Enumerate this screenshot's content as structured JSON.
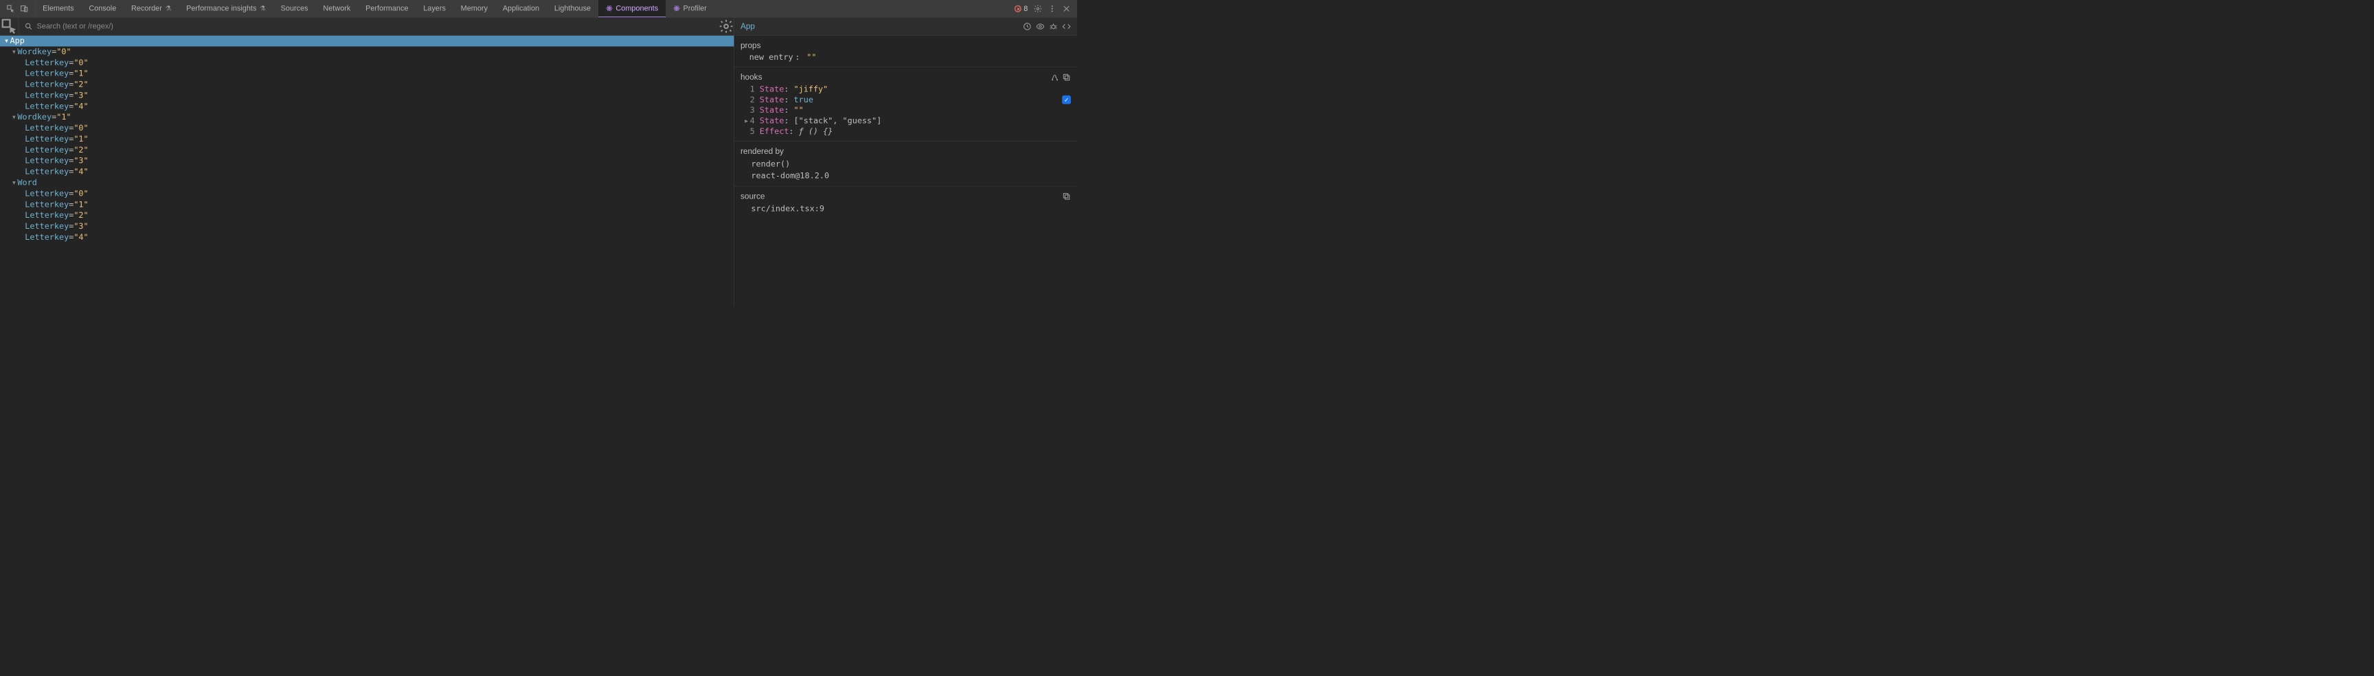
{
  "tabs": {
    "items": [
      {
        "label": "Elements",
        "id": "elements"
      },
      {
        "label": "Console",
        "id": "console"
      },
      {
        "label": "Recorder",
        "id": "recorder",
        "beaker": true
      },
      {
        "label": "Performance insights",
        "id": "perf-insights",
        "beaker": true
      },
      {
        "label": "Sources",
        "id": "sources"
      },
      {
        "label": "Network",
        "id": "network"
      },
      {
        "label": "Performance",
        "id": "performance"
      },
      {
        "label": "Layers",
        "id": "layers"
      },
      {
        "label": "Memory",
        "id": "memory"
      },
      {
        "label": "Application",
        "id": "application"
      },
      {
        "label": "Lighthouse",
        "id": "lighthouse"
      },
      {
        "label": "Components",
        "id": "components",
        "react": true,
        "active": true
      },
      {
        "label": "Profiler",
        "id": "profiler",
        "react": true
      }
    ]
  },
  "errors": {
    "count": "8"
  },
  "search": {
    "placeholder": "Search (text or /regex/)"
  },
  "selected_crumb": "App",
  "tree": [
    {
      "d": 0,
      "name": "App",
      "expandable": true,
      "selected": true
    },
    {
      "d": 1,
      "name": "Word",
      "key": "0",
      "expandable": true
    },
    {
      "d": 2,
      "name": "Letter",
      "key": "0"
    },
    {
      "d": 2,
      "name": "Letter",
      "key": "1"
    },
    {
      "d": 2,
      "name": "Letter",
      "key": "2"
    },
    {
      "d": 2,
      "name": "Letter",
      "key": "3"
    },
    {
      "d": 2,
      "name": "Letter",
      "key": "4"
    },
    {
      "d": 1,
      "name": "Word",
      "key": "1",
      "expandable": true
    },
    {
      "d": 2,
      "name": "Letter",
      "key": "0"
    },
    {
      "d": 2,
      "name": "Letter",
      "key": "1"
    },
    {
      "d": 2,
      "name": "Letter",
      "key": "2"
    },
    {
      "d": 2,
      "name": "Letter",
      "key": "3"
    },
    {
      "d": 2,
      "name": "Letter",
      "key": "4"
    },
    {
      "d": 1,
      "name": "Word",
      "expandable": true
    },
    {
      "d": 2,
      "name": "Letter",
      "key": "0"
    },
    {
      "d": 2,
      "name": "Letter",
      "key": "1"
    },
    {
      "d": 2,
      "name": "Letter",
      "key": "2"
    },
    {
      "d": 2,
      "name": "Letter",
      "key": "3"
    },
    {
      "d": 2,
      "name": "Letter",
      "key": "4"
    }
  ],
  "props": {
    "title": "props",
    "items": [
      {
        "k": "new entry",
        "v": "\"\""
      }
    ]
  },
  "hooks": {
    "title": "hooks",
    "items": [
      {
        "i": "1",
        "k": "State",
        "v": "\"jiffy\"",
        "vclass": "v-str"
      },
      {
        "i": "2",
        "k": "State",
        "v": "true",
        "vclass": "v-bool",
        "checked": true
      },
      {
        "i": "3",
        "k": "State",
        "v": "\"\"",
        "vclass": "v-str"
      },
      {
        "i": "4",
        "k": "State",
        "v": "[\"stack\", \"guess\"]",
        "vclass": "v-lit",
        "expandable": true
      },
      {
        "i": "5",
        "k": "Effect",
        "v": "ƒ () {}",
        "vclass": "v-fn"
      }
    ]
  },
  "rendered_by": {
    "title": "rendered by",
    "lines": [
      "render()",
      "react-dom@18.2.0"
    ]
  },
  "source": {
    "title": "source",
    "line": "src/index.tsx:9"
  }
}
